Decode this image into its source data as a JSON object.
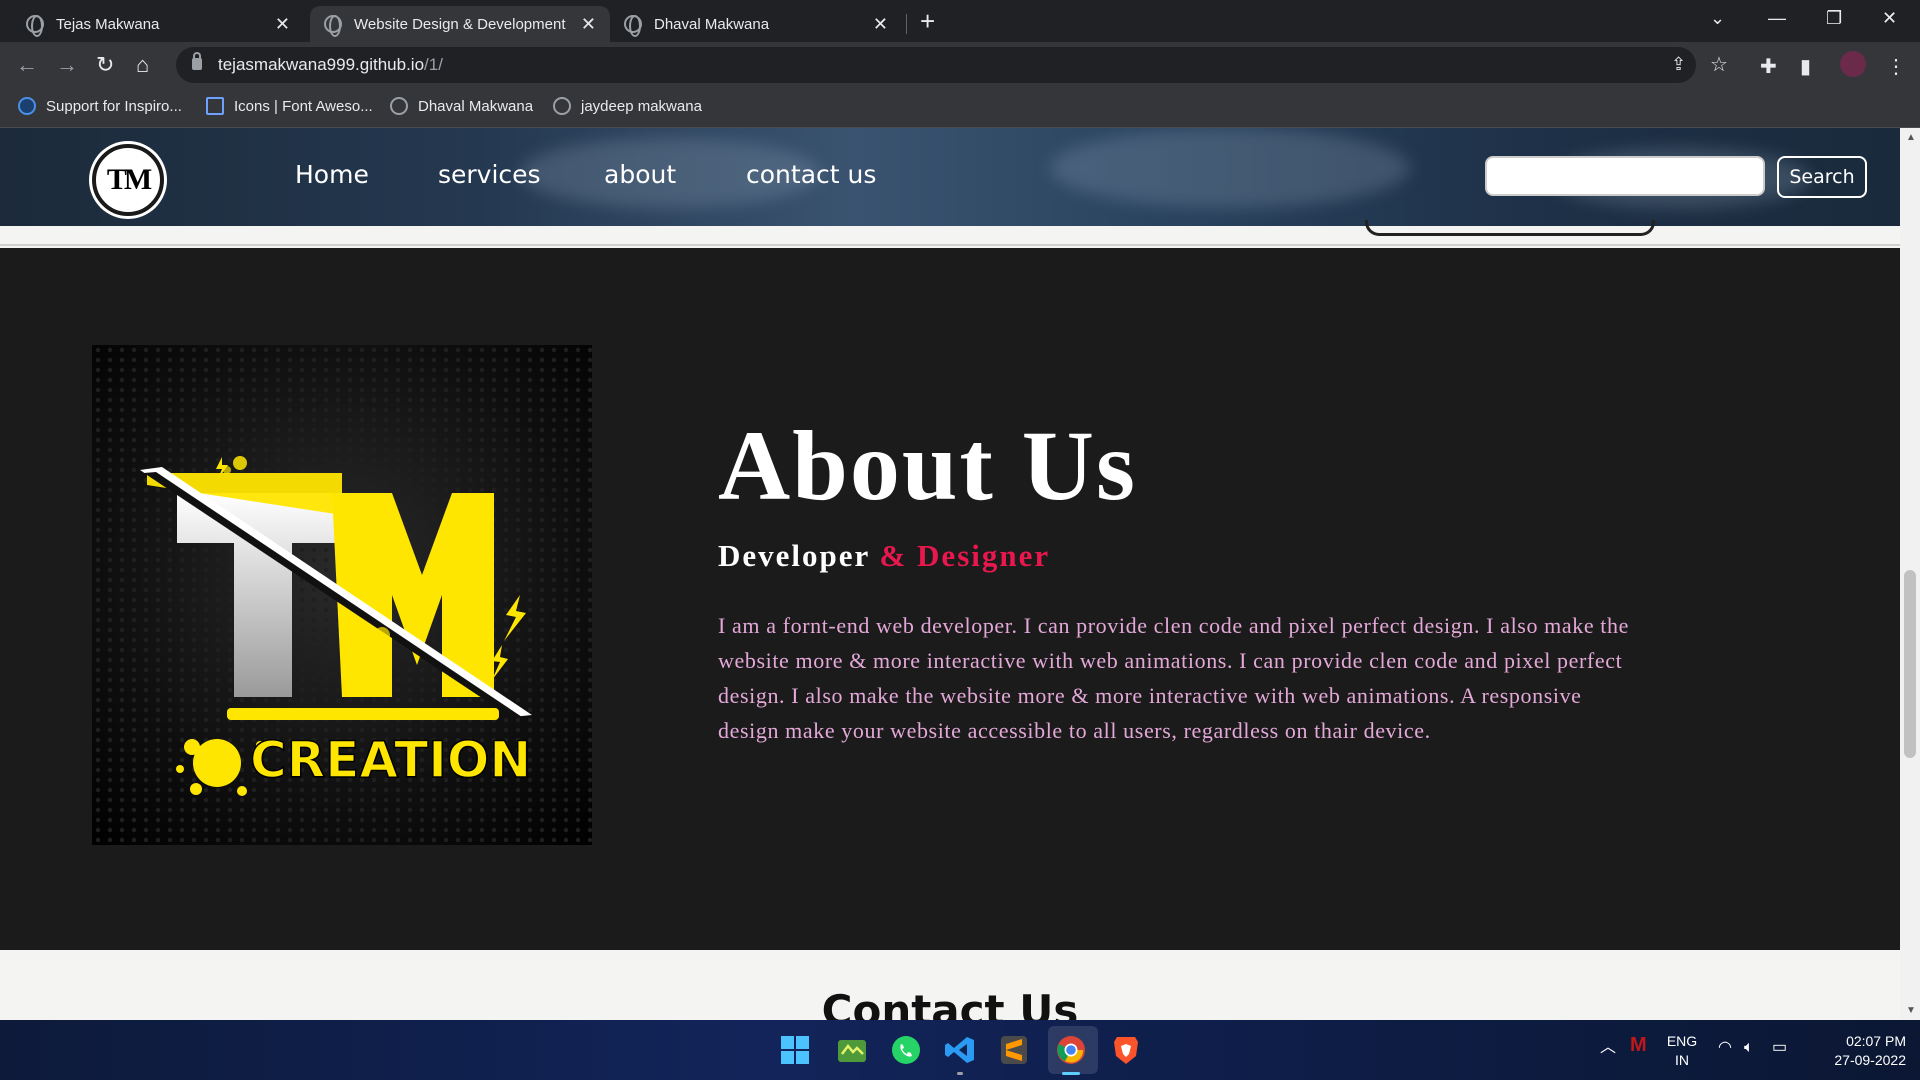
{
  "browser": {
    "tabs": [
      {
        "title": "Tejas Makwana",
        "active": false
      },
      {
        "title": "Website Design & Development",
        "active": true
      },
      {
        "title": "Dhaval Makwana",
        "active": false
      }
    ],
    "url_host": "tejasmakwana999.github.io",
    "url_path": "/1/",
    "bookmarks": [
      {
        "label": "Support for Inspiro...",
        "icon": "dell-icon"
      },
      {
        "label": "Icons | Font Aweso...",
        "icon": "flag-icon"
      },
      {
        "label": "Dhaval Makwana",
        "icon": "globe-icon"
      },
      {
        "label": "jaydeep makwana",
        "icon": "globe-icon"
      }
    ]
  },
  "site": {
    "logo_text": "TM",
    "nav": [
      "Home",
      "services",
      "about",
      "contact us"
    ],
    "search": {
      "placeholder": "",
      "button": "Search"
    },
    "about": {
      "title": "About Us",
      "subtitle_main": "Developer ",
      "subtitle_accent": "& Designer",
      "body": "I am a fornt-end web developer. I can provide clen code and pixel perfect design. I also make the website more & more interactive with web animations. I can provide clen code and pixel perfect design. I also make the website more & more interactive with web animations. A responsive design make your website accessible to all users, regardless on thair device.",
      "image_text": "CREATION"
    },
    "contact": {
      "title": "Contact Us"
    },
    "colors": {
      "accent": "#e8174e",
      "body_text": "#e3a8d8",
      "section_bg": "#1b1b1b"
    }
  },
  "taskbar": {
    "apps": [
      "windows-start-icon",
      "app-icon",
      "whatsapp-icon",
      "vscode-icon",
      "sublime-icon",
      "chrome-icon",
      "brave-icon"
    ],
    "lang_line1": "ENG",
    "lang_line2": "IN",
    "time": "02:07 PM",
    "date": "27-09-2022"
  }
}
